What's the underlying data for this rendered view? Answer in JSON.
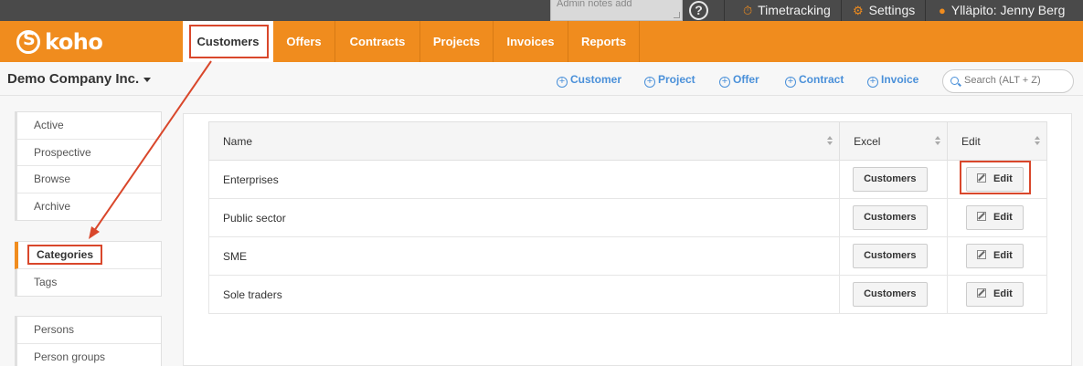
{
  "topbar": {
    "notes_placeholder": "Admin notes add",
    "help_glyph": "?",
    "timetracking_label": "Timetracking",
    "settings_label": "Settings",
    "user_label": "Ylläpito: Jenny Berg"
  },
  "nav": {
    "logo_text": "koho",
    "tabs": [
      {
        "label": "Customers",
        "active": true
      },
      {
        "label": "Offers"
      },
      {
        "label": "Contracts"
      },
      {
        "label": "Projects"
      },
      {
        "label": "Invoices"
      },
      {
        "label": "Reports"
      }
    ]
  },
  "subheader": {
    "company": "Demo Company Inc.",
    "quick_add": [
      "Customer",
      "Project",
      "Offer",
      "Contract",
      "Invoice"
    ],
    "search_placeholder": "Search (ALT + Z)"
  },
  "sidebar": {
    "group1": [
      "Active",
      "Prospective",
      "Browse",
      "Archive"
    ],
    "group2": [
      "Categories",
      "Tags"
    ],
    "group3": [
      "Persons",
      "Person groups"
    ]
  },
  "table": {
    "headers": [
      "Name",
      "Excel",
      "Edit"
    ],
    "rows": [
      {
        "name": "Enterprises",
        "excel": "Customers",
        "edit": "Edit"
      },
      {
        "name": "Public sector",
        "excel": "Customers",
        "edit": "Edit"
      },
      {
        "name": "SME",
        "excel": "Customers",
        "edit": "Edit"
      },
      {
        "name": "Sole traders",
        "excel": "Customers",
        "edit": "Edit"
      }
    ]
  },
  "colors": {
    "brand_orange": "#f08c1e",
    "link_blue": "#4a90d9",
    "annotation_red": "#d9472b",
    "topbar_dark": "#4a4a4a"
  }
}
